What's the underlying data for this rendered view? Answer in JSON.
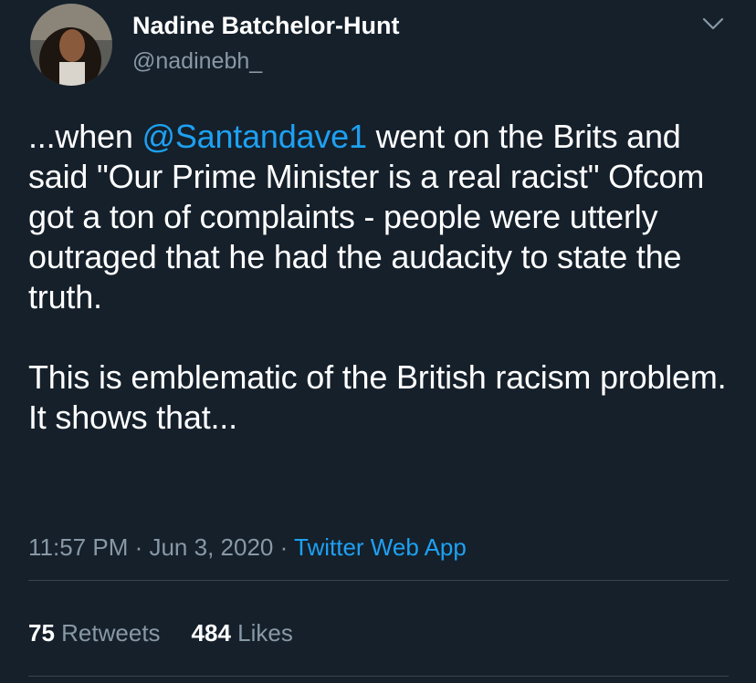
{
  "user": {
    "display_name": "Nadine Batchelor-Hunt",
    "handle": "@nadinebh_"
  },
  "tweet": {
    "p1_before": "...when ",
    "mention": "@Santandave1",
    "p1_after": " went on the Brits and said \"Our Prime Minister is a real racist\" Ofcom got a ton of complaints - people were utterly outraged that he had the audacity to state the truth.",
    "p2": "This is emblematic of the British racism problem. It shows that..."
  },
  "meta": {
    "time": "11:57 PM",
    "sep1": " · ",
    "date": "Jun 3, 2020",
    "sep2": " · ",
    "source": "Twitter Web App"
  },
  "stats": {
    "retweets_count": "75",
    "retweets_label": "Retweets",
    "likes_count": "484",
    "likes_label": "Likes"
  },
  "icons": {
    "menu": "chevron-down-icon",
    "avatar": "avatar"
  },
  "colors": {
    "background": "#15202b",
    "text": "#ffffff",
    "secondary": "#8899a6",
    "accent": "#1da1f2",
    "divider": "#38444d"
  }
}
